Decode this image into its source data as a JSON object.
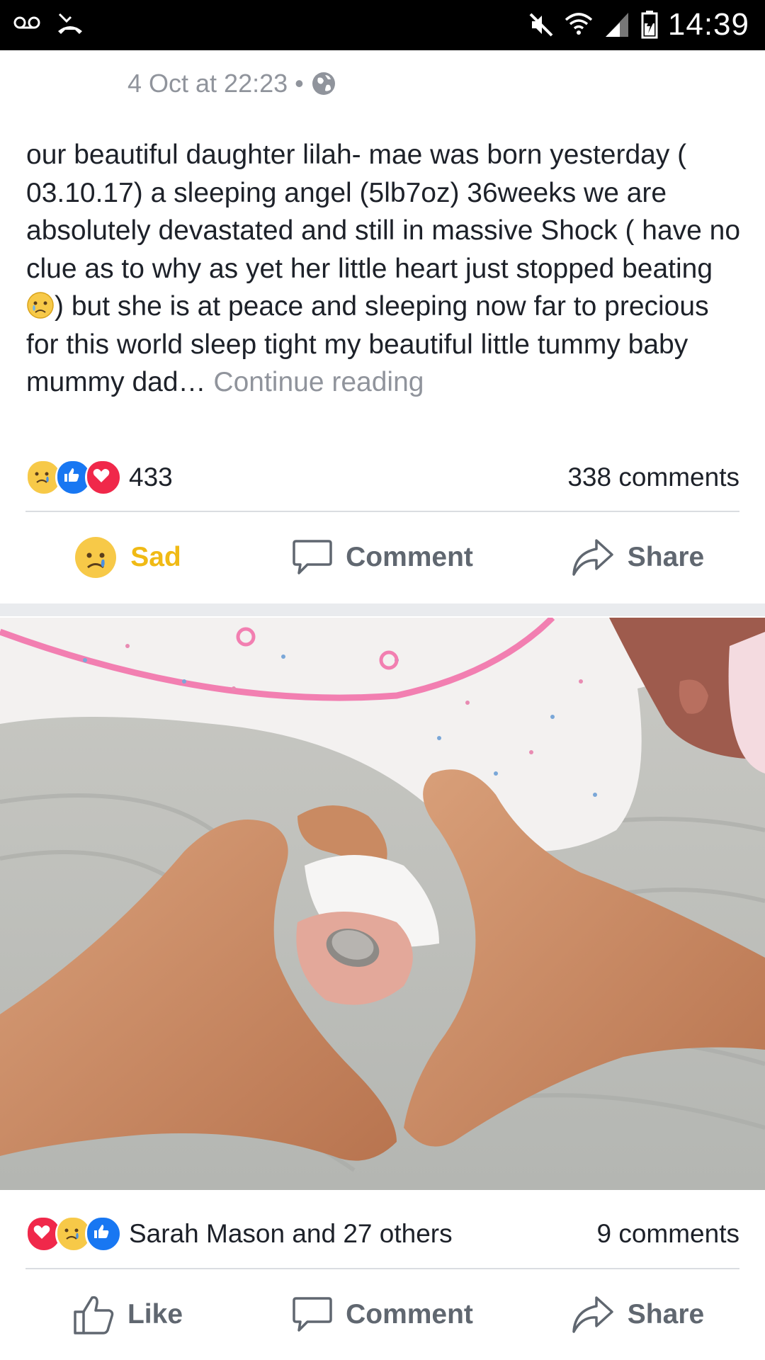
{
  "status_bar": {
    "time": "14:39",
    "left_icons": [
      "voicemail-icon",
      "missed-call-icon"
    ],
    "right_icons": [
      "mute-icon",
      "wifi-icon",
      "signal-icon",
      "battery-icon"
    ]
  },
  "post": {
    "date": "4 Oct at 22:23",
    "separator": "•",
    "privacy_icon": "globe-icon",
    "text_before_emoji": "our beautiful daughter lilah- mae was born yesterday ( 03.10.17) a sleeping angel (5lb7oz)  36weeks we are absolutely devastated and still in massive Shock ( have no clue as to why as yet her little heart just stopped beating ",
    "text_after_emoji": ") but she is at peace and sleeping now far to precious for this world sleep tight my beautiful little tummy baby mummy dad… ",
    "continue_reading": "Continue reading",
    "reactions": [
      "sad",
      "like",
      "love"
    ],
    "reaction_count": "433",
    "comments": "338 comments",
    "actions": {
      "sad": "Sad",
      "comment": "Comment",
      "share": "Share"
    }
  },
  "photo_post": {
    "reactions": [
      "love",
      "sad",
      "like"
    ],
    "reaction_summary": "Sarah Mason and 27 others",
    "comments": "9 comments",
    "actions": {
      "like": "Like",
      "comment": "Comment",
      "share": "Share"
    }
  },
  "colors": {
    "text": "#1d2129",
    "muted": "#90949c",
    "sad": "#f0ba15",
    "like": "#1877f2",
    "love": "#f0284a"
  }
}
